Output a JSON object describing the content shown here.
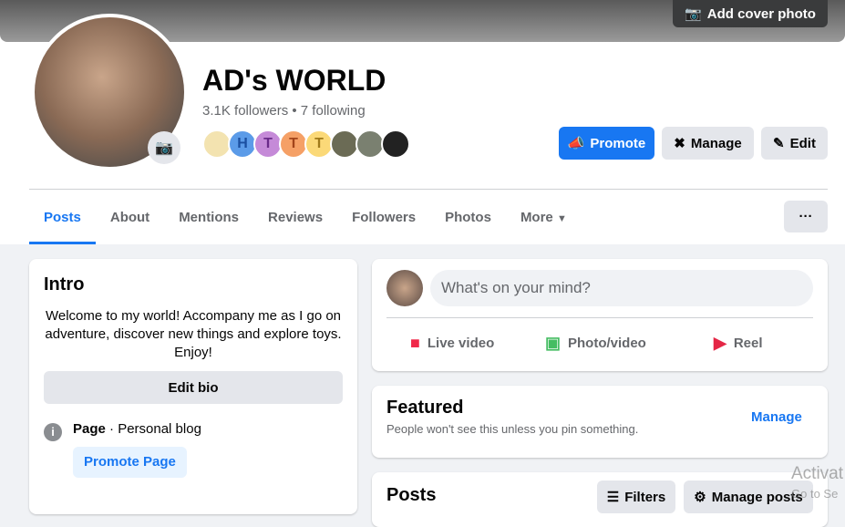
{
  "cover": {
    "add_cover_label": "Add cover photo"
  },
  "profile": {
    "name": "AD's WORLD",
    "stats": "3.1K followers • 7 following",
    "friends": [
      {
        "letter": "",
        "color": "#f3e3b0"
      },
      {
        "letter": "H",
        "color": "#5b9be8"
      },
      {
        "letter": "T",
        "color": "#c58ad8"
      },
      {
        "letter": "T",
        "color": "#f5a066"
      },
      {
        "letter": "T",
        "color": "#fbd978"
      },
      {
        "letter": "",
        "color": "#6b6b55"
      },
      {
        "letter": "",
        "color": "#7a8070"
      },
      {
        "letter": "",
        "color": "#222222"
      }
    ]
  },
  "actions": {
    "promote": "Promote",
    "manage": "Manage",
    "edit": "Edit"
  },
  "tabs": [
    "Posts",
    "About",
    "Mentions",
    "Reviews",
    "Followers",
    "Photos",
    "More"
  ],
  "intro": {
    "title": "Intro",
    "bio": "Welcome to my world! Accompany me as I go on adventure, discover new things and explore toys. Enjoy!",
    "edit_bio": "Edit bio",
    "page_label": "Page",
    "page_category": " · Personal blog",
    "promote_page": "Promote Page"
  },
  "composer": {
    "placeholder": "What's on your mind?",
    "live": "Live video",
    "photo": "Photo/video",
    "reel": "Reel"
  },
  "featured": {
    "title": "Featured",
    "subtitle": "People won't see this unless you pin something.",
    "manage": "Manage"
  },
  "posts": {
    "title": "Posts",
    "filters": "Filters",
    "manage_posts": "Manage posts"
  },
  "watermark": {
    "line1": "Activat",
    "line2": "Go to Se"
  },
  "colors": {
    "accent": "#1877f2"
  }
}
